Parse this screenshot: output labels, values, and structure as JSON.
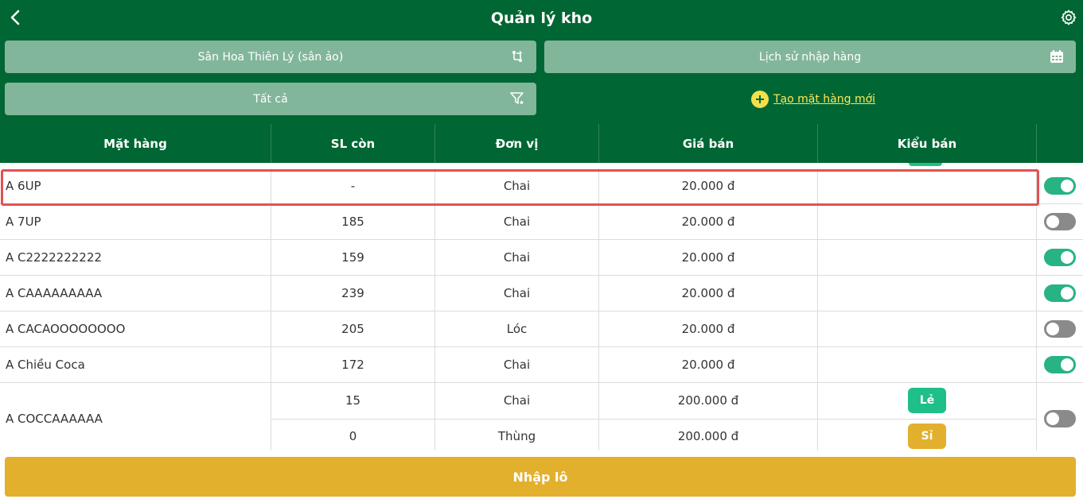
{
  "header": {
    "title": "Quản lý kho",
    "back_icon": "chevron-left-icon",
    "settings_icon": "gear-icon"
  },
  "filters": {
    "store": {
      "label": "Sân Hoa Thiên Lý (sân ảo)",
      "icon": "swap-icon"
    },
    "history": {
      "label": "Lịch sử nhập hàng",
      "icon": "calendar-icon"
    },
    "category": {
      "label": "Tất cả",
      "icon": "filter-icon"
    },
    "create_new": {
      "label": "Tạo mặt hàng mới",
      "icon": "plus-circle-icon"
    }
  },
  "table": {
    "columns": [
      "Mặt hàng",
      "SL còn",
      "Đơn vị",
      "Giá bán",
      "Kiểu bán",
      ""
    ],
    "rows": [
      {
        "name": "A 6UP",
        "qty": "-",
        "unit": "Chai",
        "price": "20.000 đ",
        "sale_type": "",
        "active": true,
        "highlighted": true
      },
      {
        "name": "A 7UP",
        "qty": "185",
        "unit": "Chai",
        "price": "20.000 đ",
        "sale_type": "",
        "active": false
      },
      {
        "name": "A C2222222222",
        "qty": "159",
        "unit": "Chai",
        "price": "20.000 đ",
        "sale_type": "",
        "active": true
      },
      {
        "name": "A CAAAAAAAAA",
        "qty": "239",
        "unit": "Chai",
        "price": "20.000 đ",
        "sale_type": "",
        "active": true
      },
      {
        "name": "A CACAOOOOOOOO",
        "qty": "205",
        "unit": "Lóc",
        "price": "20.000 đ",
        "sale_type": "",
        "active": false
      },
      {
        "name": "A Chiều Coca",
        "qty": "172",
        "unit": "Chai",
        "price": "20.000 đ",
        "sale_type": "",
        "active": true
      }
    ],
    "multi_row": {
      "name": "A COCCAAAAAA",
      "active": false,
      "variants": [
        {
          "qty": "15",
          "unit": "Chai",
          "price": "200.000 đ",
          "sale_type": "Lẻ",
          "badge_color": "#1fbf8a"
        },
        {
          "qty": "0",
          "unit": "Thùng",
          "price": "200.000 đ",
          "sale_type": "Sỉ",
          "badge_color": "#e2b02c"
        }
      ]
    }
  },
  "footer": {
    "import_label": "Nhập lô"
  },
  "colors": {
    "primary": "#006633",
    "filter_bg": "#82b69b",
    "accent": "#e2b02c",
    "toggle_on": "#27b382",
    "toggle_off": "#8a8a8a",
    "highlight": "#e05252"
  }
}
